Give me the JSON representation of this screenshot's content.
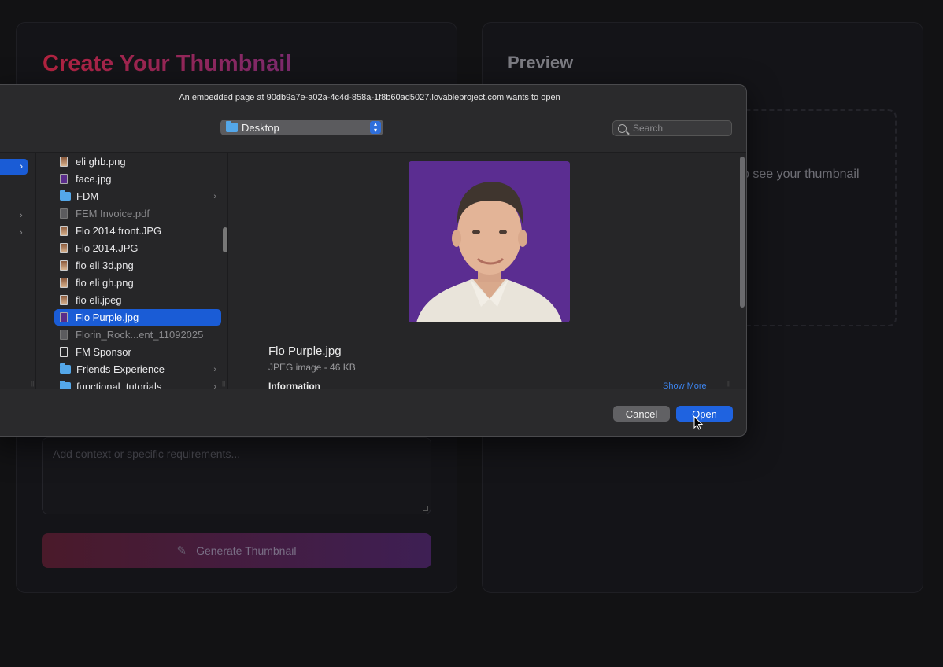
{
  "app": {
    "title": "Create Your Thumbnail",
    "preview_title": "Preview",
    "preview_hint": "o see your thumbnail",
    "context_placeholder": "Add context or specific requirements...",
    "generate_label": "Generate Thumbnail"
  },
  "dialog": {
    "title": "An embedded page at 90db9a7e-a02a-4c4d-858a-1f8b60ad5027.lovableproject.com wants to open",
    "location": "Desktop",
    "search_placeholder": "Search",
    "files": [
      {
        "name": "eli ghb.png",
        "icon": "image-file-icon"
      },
      {
        "name": "face.jpg",
        "icon": "image-file-icon"
      },
      {
        "name": "FDM",
        "icon": "folder-icon"
      },
      {
        "name": "FEM Invoice.pdf",
        "icon": "document-file-icon"
      },
      {
        "name": "Flo 2014 front.JPG",
        "icon": "image-file-icon"
      },
      {
        "name": "Flo 2014.JPG",
        "icon": "image-file-icon"
      },
      {
        "name": "flo eli 3d.png",
        "icon": "image-file-icon"
      },
      {
        "name": "flo eli gh.png",
        "icon": "image-file-icon"
      },
      {
        "name": "flo eli.jpeg",
        "icon": "image-file-icon"
      },
      {
        "name": "Flo Purple.jpg",
        "icon": "image-file-icon"
      },
      {
        "name": "Florin_Rock...ent_11092025",
        "icon": "document-file-icon"
      },
      {
        "name": "FM Sponsor",
        "icon": "blank-file-icon"
      },
      {
        "name": "Friends Experience",
        "icon": "folder-icon"
      },
      {
        "name": "functional_tutorials",
        "icon": "folder-icon"
      }
    ],
    "selected_file": "Flo Purple.jpg",
    "preview_name": "Flo Purple.jpg",
    "preview_kind": "JPEG image - 46 KB",
    "information_label": "Information",
    "show_more": "Show More",
    "cancel_label": "Cancel",
    "open_label": "Open",
    "accent_color": "#1f63e0"
  }
}
